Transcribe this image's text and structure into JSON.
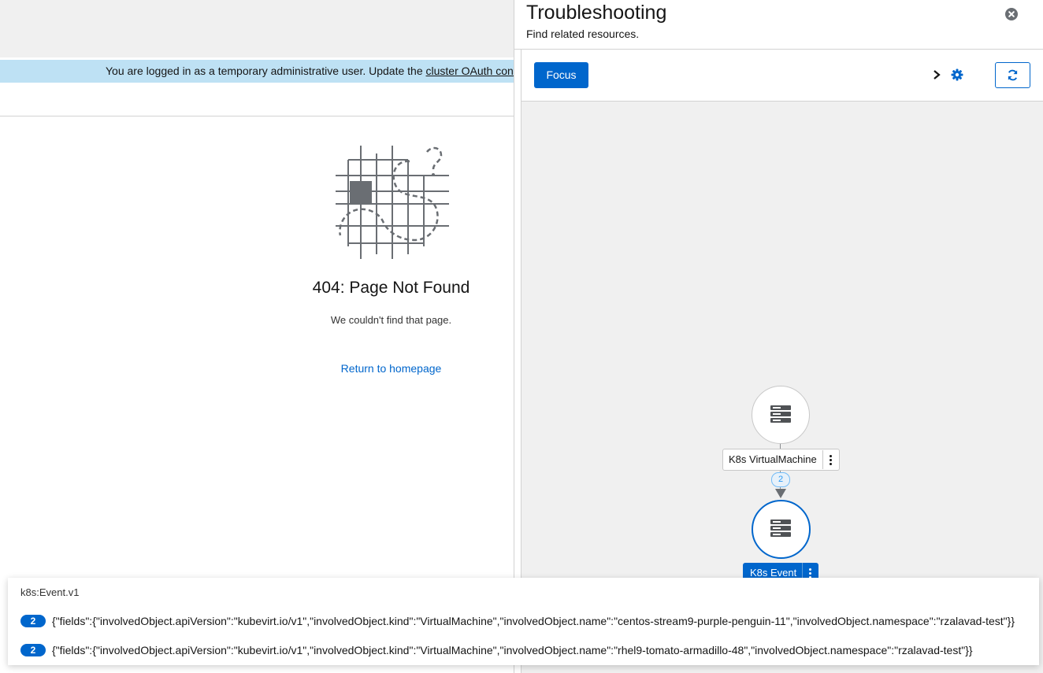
{
  "banner": {
    "text": "You are logged in as a temporary administrative user. Update the ",
    "link": "cluster OAuth conf"
  },
  "not_found": {
    "title": "404: Page Not Found",
    "body": "We couldn't find that page.",
    "link": "Return to homepage"
  },
  "drawer": {
    "title": "Troubleshooting",
    "subtitle": "Find related resources.",
    "focus_label": "Focus"
  },
  "graph": {
    "node1_label": "K8s VirtualMachine",
    "edge_count": "2",
    "node2_label": "K8s Event"
  },
  "popover": {
    "title": "k8s:Event.v1",
    "rows": [
      {
        "count": "2",
        "text": "{\"fields\":{\"involvedObject.apiVersion\":\"kubevirt.io/v1\",\"involvedObject.kind\":\"VirtualMachine\",\"involvedObject.name\":\"centos-stream9-purple-penguin-11\",\"involvedObject.namespace\":\"rzalavad-test\"}}"
      },
      {
        "count": "2",
        "text": "{\"fields\":{\"involvedObject.apiVersion\":\"kubevirt.io/v1\",\"involvedObject.kind\":\"VirtualMachine\",\"involvedObject.name\":\"rhel9-tomato-armadillo-48\",\"involvedObject.namespace\":\"rzalavad-test\"}}"
      }
    ]
  },
  "icons": [
    "close-icon",
    "chevron-right-icon",
    "gear-icon",
    "refresh-icon",
    "server-icon",
    "kebab-icon",
    "not-found-illustration"
  ],
  "colors": {
    "primary": "#0066cc",
    "banner": "#bee1f4",
    "canvas": "#f0f0f0"
  }
}
